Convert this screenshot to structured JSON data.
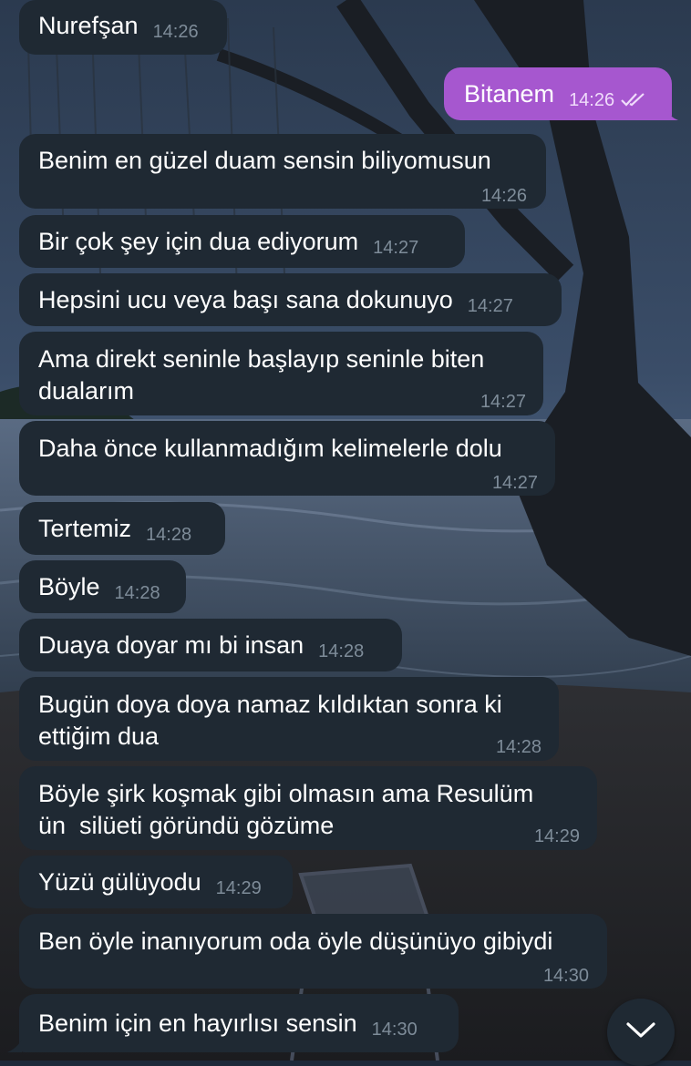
{
  "messages": [
    {
      "id": "m1",
      "dir": "in",
      "text": "Nurefşan",
      "time": "14:26"
    },
    {
      "id": "m2",
      "dir": "out",
      "text": "Bitanem",
      "time": "14:26",
      "status": "read-double-check"
    },
    {
      "id": "m3",
      "dir": "in",
      "text": "Benim en güzel duam sensin biliyomusun",
      "time": "14:26"
    },
    {
      "id": "m4",
      "dir": "in",
      "text": "Bir çok şey için dua ediyorum",
      "time": "14:27"
    },
    {
      "id": "m5",
      "dir": "in",
      "text": "Hepsini ucu veya başı sana dokunuyo",
      "time": "14:27"
    },
    {
      "id": "m6",
      "dir": "in",
      "line1": "Ama direkt seninle başlayıp seninle biten",
      "line2": "dualarım",
      "time": "14:27"
    },
    {
      "id": "m7",
      "dir": "in",
      "text": "Daha önce kullanmadığım kelimelerle dolu",
      "time": "14:27"
    },
    {
      "id": "m8",
      "dir": "in",
      "text": "Tertemiz",
      "time": "14:28"
    },
    {
      "id": "m9",
      "dir": "in",
      "text": "Böyle",
      "time": "14:28"
    },
    {
      "id": "m10",
      "dir": "in",
      "text": "Duaya doyar mı bi insan",
      "time": "14:28"
    },
    {
      "id": "m11",
      "dir": "in",
      "line1": "Bugün doya doya namaz kıldıktan sonra ki",
      "line2": "ettiğim dua",
      "time": "14:28"
    },
    {
      "id": "m12",
      "dir": "in",
      "line1": "Böyle şirk koşmak gibi olmasın ama Resulüm",
      "line2": "ün  silüeti göründü gözüme",
      "time": "14:29"
    },
    {
      "id": "m13",
      "dir": "in",
      "text": "Yüzü gülüyodu",
      "time": "14:29"
    },
    {
      "id": "m14",
      "dir": "in",
      "text": "Ben öyle inanıyorum oda öyle düşünüyo gibiydi",
      "time": "14:30"
    },
    {
      "id": "m15",
      "dir": "in",
      "text": "Benim için en hayırlısı sensin",
      "time": "14:30"
    }
  ],
  "icons": {
    "scroll_down": "chevron-down-icon",
    "read_status": "double-check-icon"
  },
  "colors": {
    "incoming_bubble": "#1f2933",
    "outgoing_bubble": "#a657cf",
    "text": "#ffffff",
    "timestamp": "#7e8c99"
  }
}
